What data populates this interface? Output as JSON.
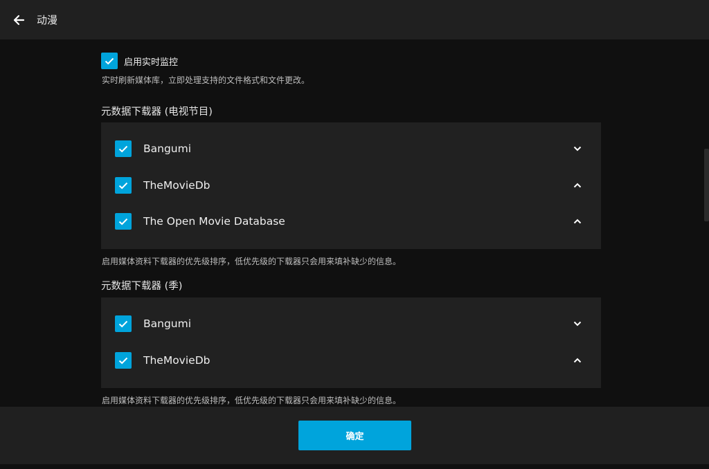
{
  "header": {
    "title": "动漫",
    "back_icon": "arrow-left-icon"
  },
  "realtime": {
    "label": "启用实时监控",
    "checked": true,
    "help": "实时刷新媒体库，立即处理支持的文件格式和文件更改。"
  },
  "tv_fetchers": {
    "title": "元数据下载器 (电视节目)",
    "items": [
      {
        "label": "Bangumi",
        "checked": true,
        "chevron": "chevron-down-icon"
      },
      {
        "label": "TheMovieDb",
        "checked": true,
        "chevron": "chevron-up-icon"
      },
      {
        "label": "The Open Movie Database",
        "checked": true,
        "chevron": "chevron-up-icon"
      }
    ],
    "help": "启用媒体资料下载器的优先级排序，低优先级的下载器只会用来填补缺少的信息。"
  },
  "season_fetchers": {
    "title": "元数据下载器 (季)",
    "items": [
      {
        "label": "Bangumi",
        "checked": true,
        "chevron": "chevron-down-icon"
      },
      {
        "label": "TheMovieDb",
        "checked": true,
        "chevron": "chevron-up-icon"
      }
    ],
    "help": "启用媒体资料下载器的优先级排序，低优先级的下载器只会用来填补缺少的信息。"
  },
  "footer": {
    "confirm_label": "确定"
  },
  "colors": {
    "accent": "#00a4dc",
    "background": "#101010",
    "panel": "#212121",
    "header": "#202020"
  }
}
